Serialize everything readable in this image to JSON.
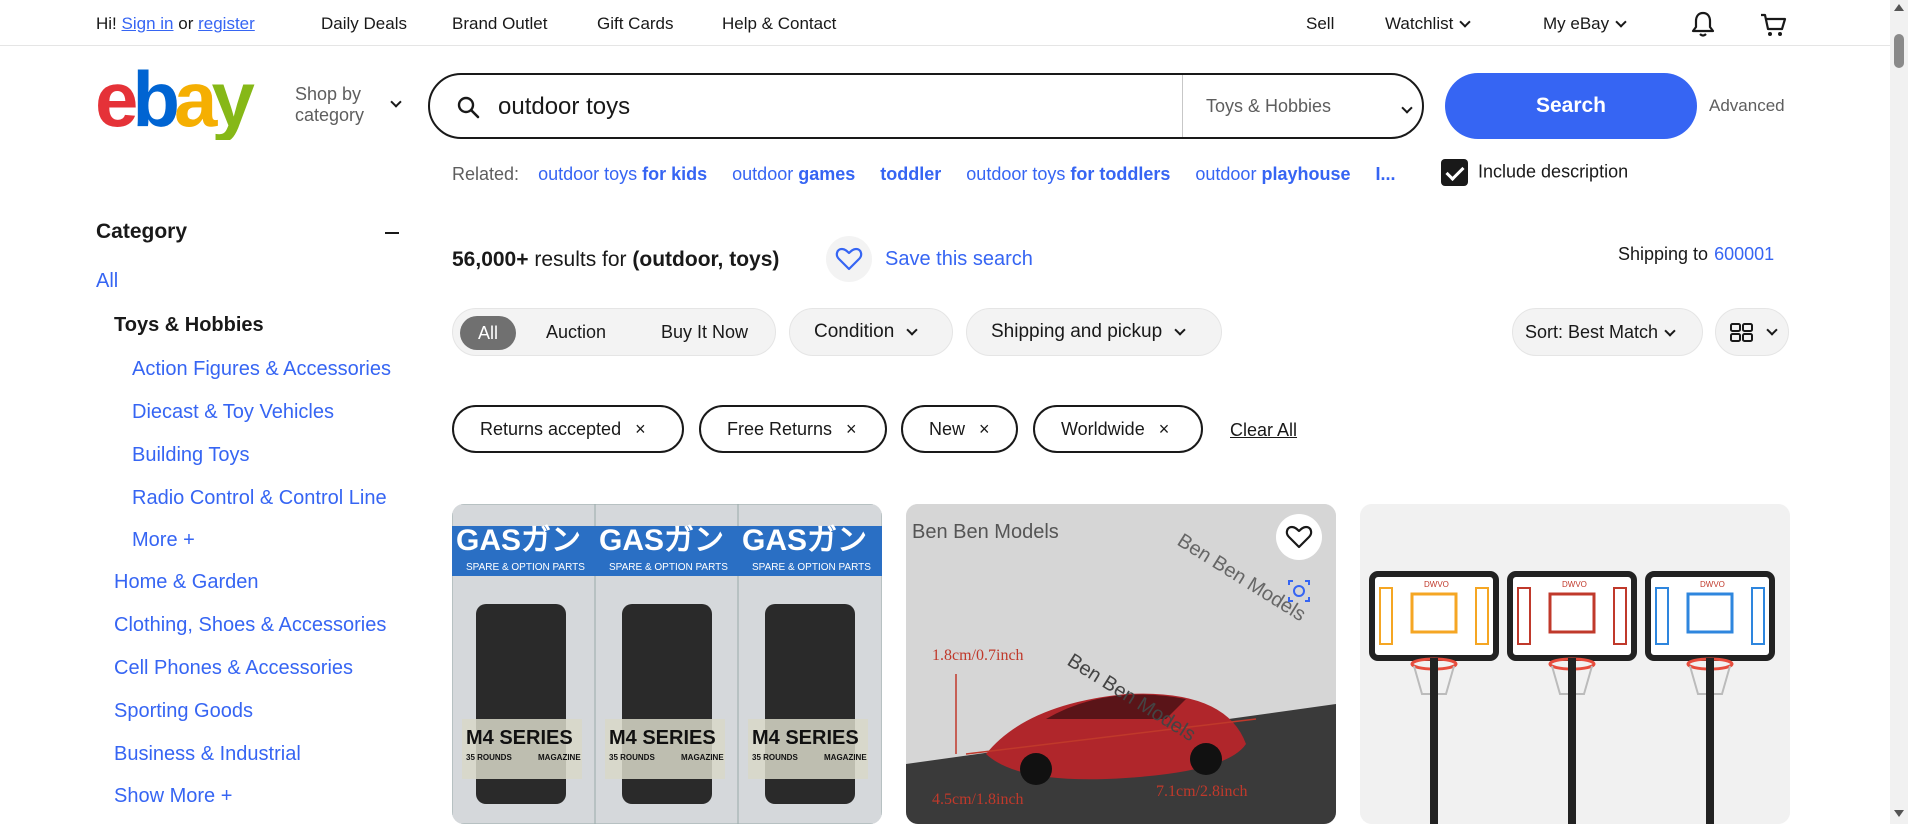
{
  "topbar": {
    "greeting_hi": "Hi!",
    "sign_in": "Sign in",
    "or": "or",
    "register": "register",
    "daily_deals": "Daily Deals",
    "brand_outlet": "Brand Outlet",
    "gift_cards": "Gift Cards",
    "help_contact": "Help & Contact",
    "sell": "Sell",
    "watchlist": "Watchlist",
    "my_ebay": "My eBay"
  },
  "header": {
    "logo_letters": [
      "e",
      "b",
      "a",
      "y"
    ],
    "logo_colors": [
      "#e53238",
      "#0064d2",
      "#f5af02",
      "#86b817"
    ],
    "shop_by_line1": "Shop by",
    "shop_by_line2": "category",
    "search_query": "outdoor toys",
    "search_category": "Toys & Hobbies",
    "search_button": "Search",
    "advanced": "Advanced"
  },
  "related": {
    "label": "Related:",
    "links": [
      {
        "prefix": "outdoor toys ",
        "bold": "for kids"
      },
      {
        "prefix": "outdoor ",
        "bold": "games"
      },
      {
        "prefix": "",
        "bold": "toddler"
      },
      {
        "prefix": "outdoor toys ",
        "bold": "for toddlers"
      },
      {
        "prefix": "outdoor ",
        "bold": "playhouse"
      }
    ],
    "overflow": "I...",
    "include_description": "Include description"
  },
  "sidebar": {
    "heading": "Category",
    "all": "All",
    "selected": "Toys & Hobbies",
    "subcategories": [
      "Action Figures & Accessories",
      "Diecast & Toy Vehicles",
      "Building Toys",
      "Radio Control & Control Line"
    ],
    "more": "More +",
    "categories": [
      "Home & Garden",
      "Clothing, Shoes & Accessories",
      "Cell Phones & Accessories",
      "Sporting Goods",
      "Business & Industrial"
    ],
    "show_more": "Show More +"
  },
  "results": {
    "count": "56,000+",
    "results_for": "results for",
    "query": "(outdoor, toys)",
    "save_search": "Save this search",
    "shipping_to": "Shipping to",
    "zip": "600001"
  },
  "filters": {
    "format_options": [
      "All",
      "Auction",
      "Buy It Now"
    ],
    "condition": "Condition",
    "shipping_pickup": "Shipping and pickup",
    "sort": "Sort: Best Match",
    "applied": [
      "Returns accepted",
      "Free Returns",
      "New",
      "Worldwide"
    ],
    "clear_all": "Clear All"
  },
  "products": {
    "card1": {
      "brand_text": "GASガン",
      "sub_text": "SPARE & OPTION PARTS",
      "series": "M4 SERIES",
      "rounds": "35 ROUNDS",
      "magazine": "MAGAZINE"
    },
    "card2": {
      "watermark": "Ben Ben Models",
      "dim1": "1.8cm/0.7inch",
      "dim2": "7.1cm/2.8inch",
      "dim3": "4.5cm/1.8inch"
    },
    "card3": {
      "brand": "DWVO"
    }
  },
  "colors": {
    "accent": "#3665f3",
    "text": "#191919",
    "muted": "#5e5e5e"
  }
}
